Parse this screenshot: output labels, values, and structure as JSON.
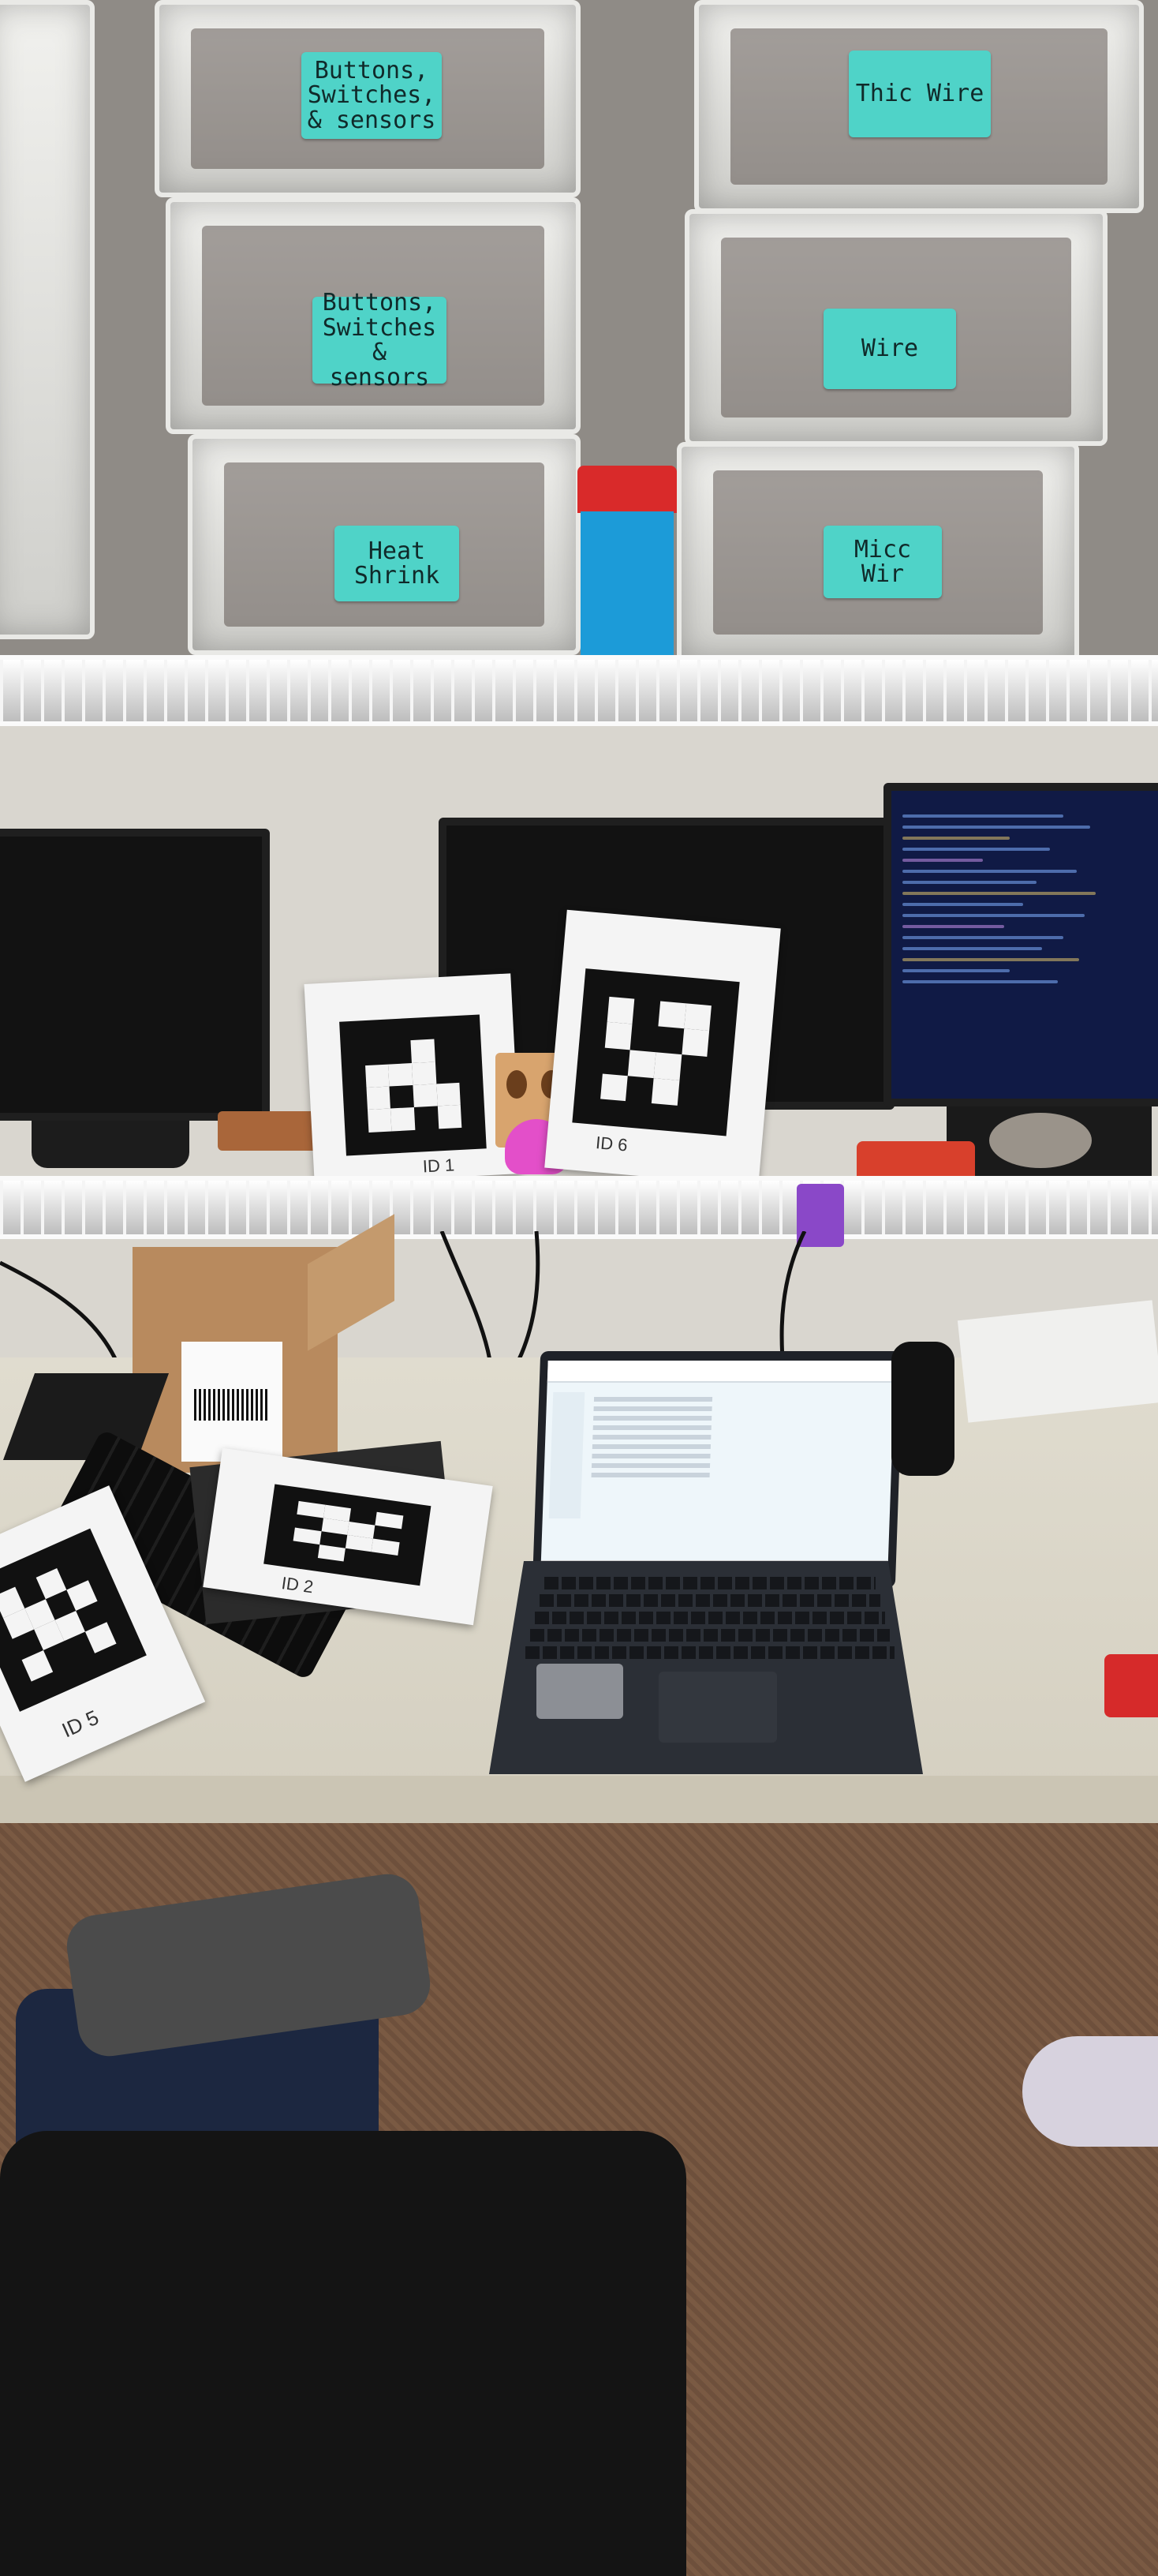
{
  "scene": {
    "drawer_labels": {
      "left_top": "Buttons, Switches, & sensors",
      "left_middle": "Buttons, Switches & sensors",
      "left_bottom": "Heat Shrink",
      "right_top": "Thic Wire",
      "right_middle": "Wire",
      "right_bottom": "Micc Wir"
    },
    "markers": {
      "id1": "ID 1",
      "id6": "ID 6",
      "id2": "ID 2",
      "id5": "ID 5"
    },
    "colors": {
      "label_teal": "#4fd3c8",
      "cup_red": "#d92a2a",
      "cup_blue": "#1c9bd8",
      "duck_pink": "#e34fc9",
      "code_background": "#101a45"
    }
  }
}
